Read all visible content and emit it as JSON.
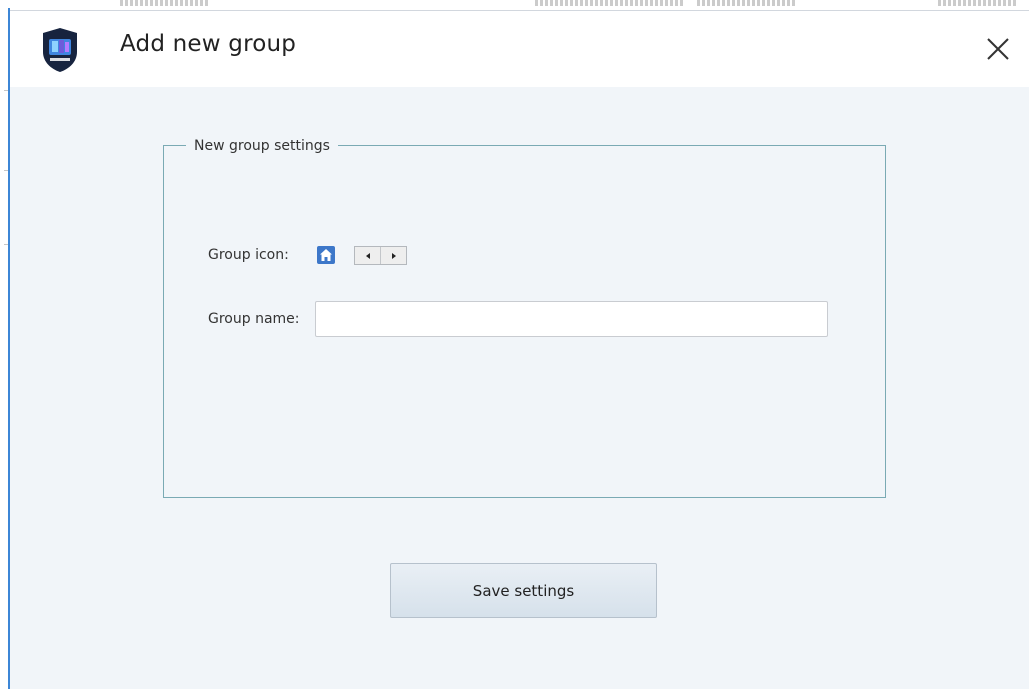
{
  "dialog": {
    "title": "Add new group",
    "close_icon": "close-icon",
    "logo_icon": "app-shield-logo-icon"
  },
  "groupbox": {
    "legend": "New group settings",
    "group_icon_label": "Group icon:",
    "group_icon": "home-icon",
    "prev_icon": "caret-left-icon",
    "next_icon": "caret-right-icon",
    "group_name_label": "Group name:",
    "group_name_value": ""
  },
  "footer": {
    "save_label": "Save settings"
  },
  "colors": {
    "accent": "#3c86d6",
    "group_icon_bg": "#3d77c9",
    "groupbox_border": "#7aaab4",
    "dialog_bg": "#f1f5f9"
  }
}
